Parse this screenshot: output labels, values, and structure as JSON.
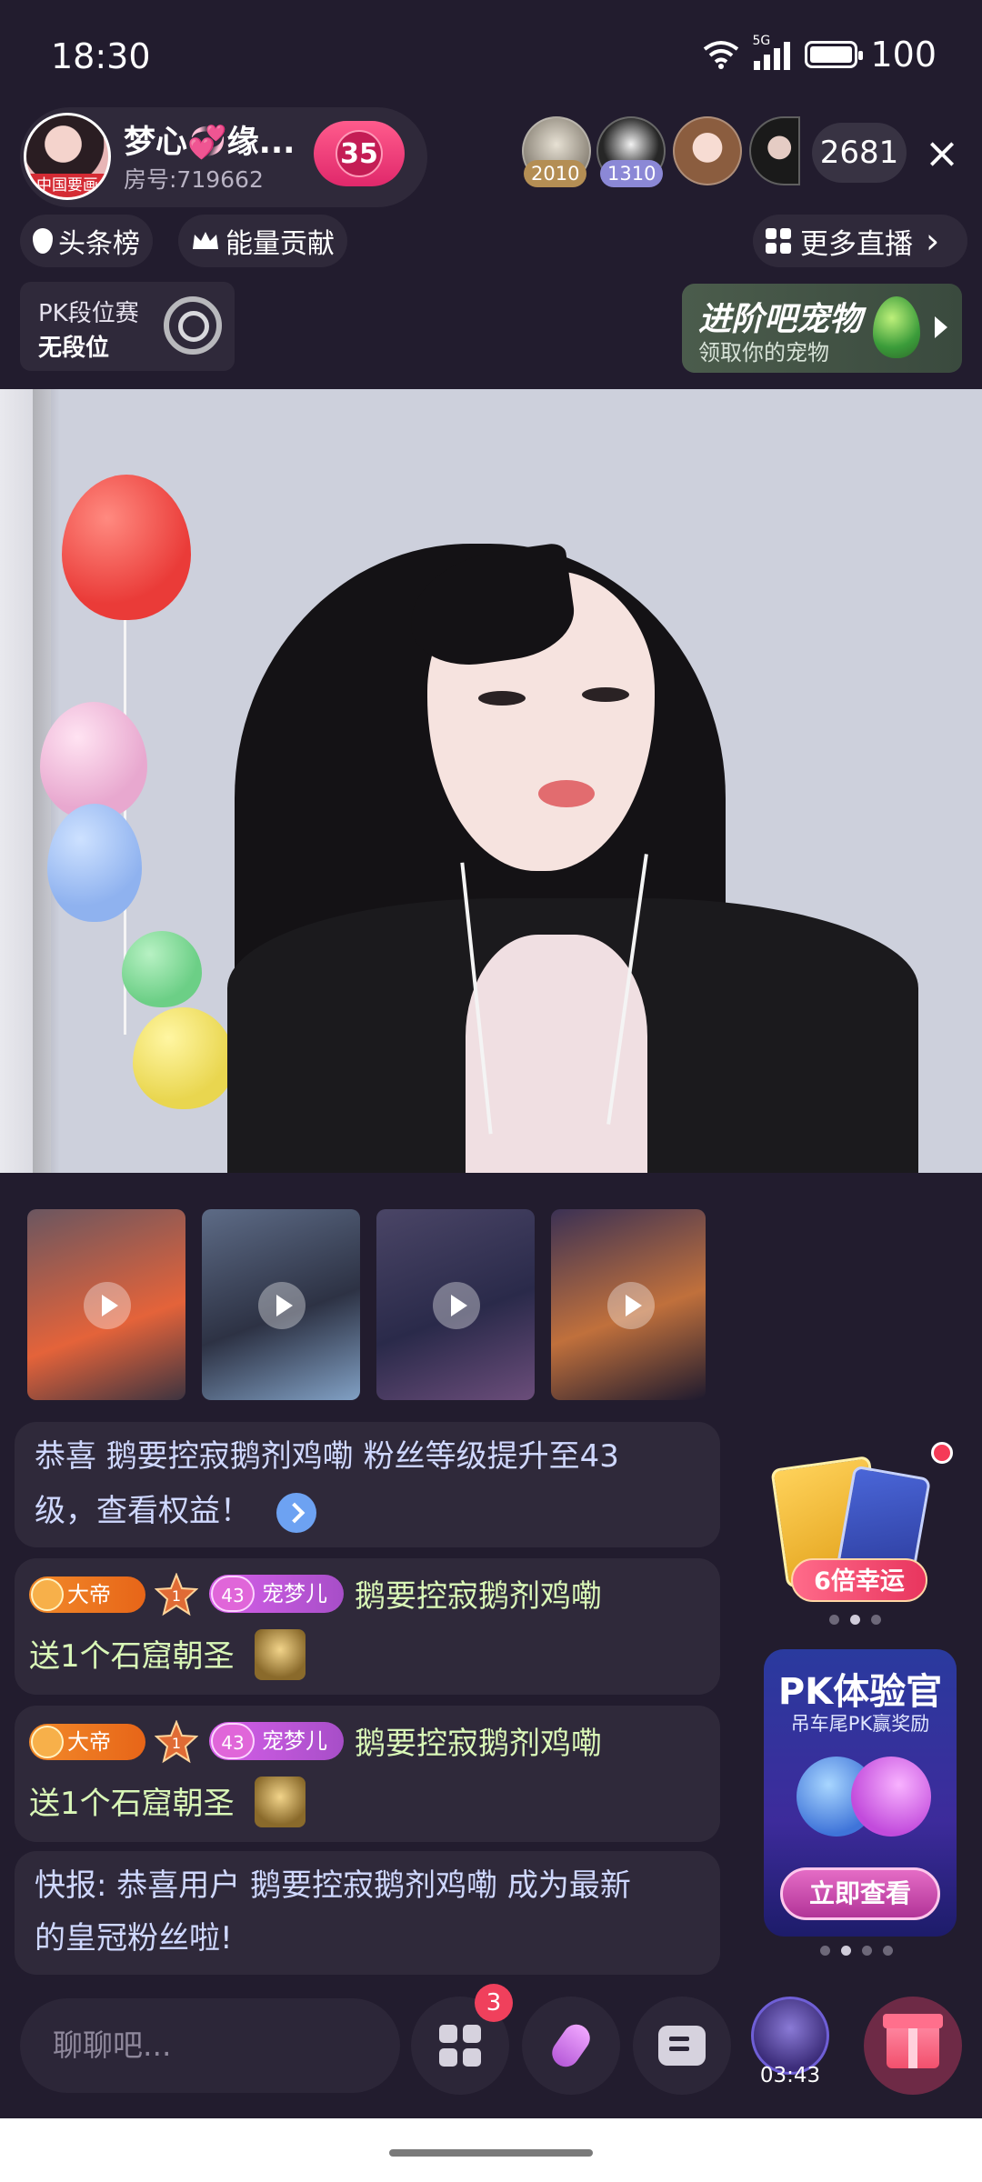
{
  "status_bar": {
    "time": "18:30",
    "network": "5G",
    "battery": "100",
    "icons": [
      "wifi-icon",
      "signal-icon",
      "battery-icon"
    ]
  },
  "host": {
    "name": "梦心💞缘...",
    "room_id": "房号:719662",
    "avatar_tag": "中国要画",
    "follow_count": "35"
  },
  "viewers": {
    "avatars": [
      {
        "badge": "2010"
      },
      {
        "badge": "1310"
      },
      {
        "badge": ""
      },
      {
        "badge": ""
      }
    ],
    "count": "2681",
    "close_icon": "×"
  },
  "chips": {
    "headline": "头条榜",
    "energy": "能量贡献",
    "more_live": "更多直播",
    "more_live_arrow": "›"
  },
  "pk_rank": {
    "title": "PK段位赛",
    "status": "无段位"
  },
  "pet_banner": {
    "title": "进阶吧宠物",
    "subtitle": "领取你的宠物"
  },
  "messages": {
    "fan_level": {
      "text_line1": "恭喜 鹅要控寂鹅剂鸡嘞 粉丝等级提升至43",
      "text_line2": "级，查看权益！"
    },
    "gift1": {
      "badge_title": "大帝",
      "level": "1",
      "fan_level": "43",
      "fan_name": "宠梦儿",
      "user": "鹅要控寂鹅剂鸡嘞",
      "gift_text": "送1个石窟朝圣"
    },
    "gift2": {
      "badge_title": "大帝",
      "level": "1",
      "fan_level": "43",
      "fan_name": "宠梦儿",
      "user": "鹅要控寂鹅剂鸡嘞",
      "gift_text": "送1个石窟朝圣"
    },
    "news": {
      "text_line1": "快报: 恭喜用户 鹅要控寂鹅剂鸡嘞 成为最新",
      "text_line2": "的皇冠粉丝啦!"
    }
  },
  "lucky": {
    "label": "6倍幸运"
  },
  "pk_promo": {
    "title": "PK体验官",
    "subtitle": "吊车尾PK赢奖励",
    "button": "立即查看"
  },
  "bottom_bar": {
    "chat_placeholder": "聊聊吧...",
    "notification_count": "3",
    "game_timer": "03:43"
  },
  "colors": {
    "background": "#221c2e",
    "accent_pink": "#e8355e",
    "chat_blue": "#cfd8ff",
    "gift_green": "#d9f7b7"
  }
}
